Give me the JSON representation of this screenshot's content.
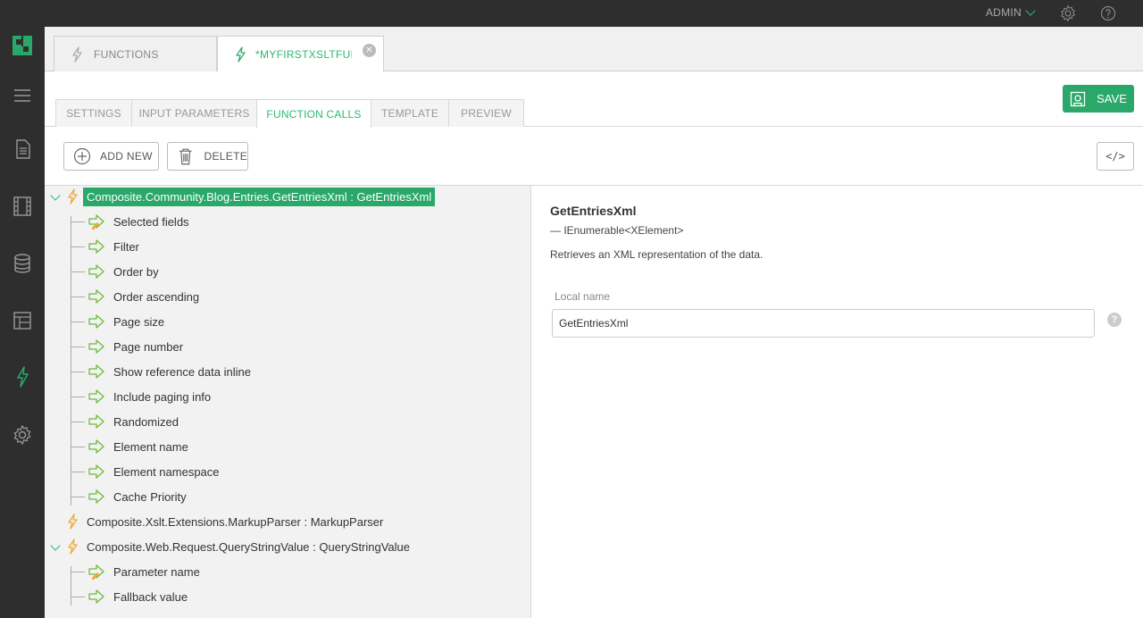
{
  "topbar": {
    "user": "ADMIN"
  },
  "doc_tabs": [
    {
      "label": "FUNCTIONS"
    },
    {
      "label": "*MYFIRSTXSLTFUNC"
    }
  ],
  "subtabs": [
    {
      "label": "SETTINGS"
    },
    {
      "label": "INPUT PARAMETERS"
    },
    {
      "label": "FUNCTION CALLS"
    },
    {
      "label": "TEMPLATE"
    },
    {
      "label": "PREVIEW"
    }
  ],
  "save_label": "SAVE",
  "toolbar": {
    "add_new": "ADD NEW",
    "delete": "DELETE",
    "code": "</>"
  },
  "tree": {
    "call1": {
      "label": "Composite.Community.Blog.Entries.GetEntriesXml : GetEntriesXml",
      "params": [
        "Selected fields",
        "Filter",
        "Order by",
        "Order ascending",
        "Page size",
        "Page number",
        "Show reference data inline",
        "Include paging info",
        "Randomized",
        "Element name",
        "Element namespace",
        "Cache Priority"
      ]
    },
    "call2": {
      "label": "Composite.Xslt.Extensions.MarkupParser : MarkupParser"
    },
    "call3": {
      "label": "Composite.Web.Request.QueryStringValue : QueryStringValue",
      "params": [
        "Parameter name",
        "Fallback value"
      ]
    }
  },
  "details": {
    "title": "GetEntriesXml",
    "signature": "— IEnumerable<XElement>",
    "description": "Retrieves an XML representation of the data.",
    "local_name_label": "Local name",
    "local_name_value": "GetEntriesXml",
    "help": "?"
  },
  "colors": {
    "accent": "#2aa86a",
    "bolt": "#f0a830",
    "dark": "#2e2e2e"
  }
}
